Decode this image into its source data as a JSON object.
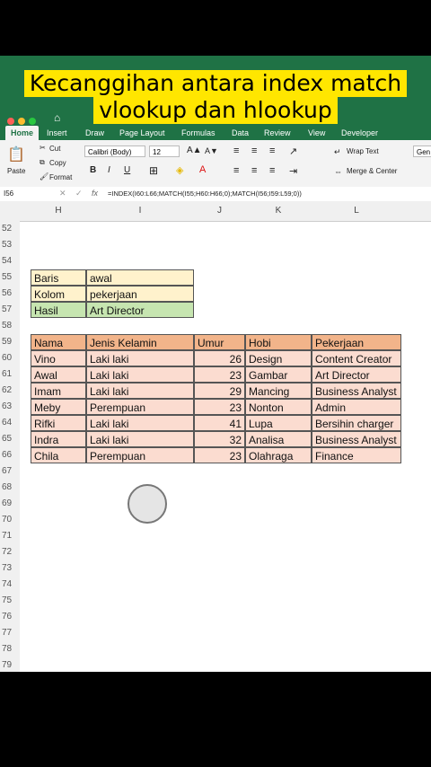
{
  "caption": {
    "line1": "Kecanggihan antara index match",
    "line2": "vlookup dan hlookup"
  },
  "ribbon": {
    "tabs": [
      "Home",
      "Insert",
      "Draw",
      "Page Layout",
      "Formulas",
      "Data",
      "Review",
      "View",
      "Developer"
    ],
    "cut": "Cut",
    "copy": "Copy",
    "format": "Format",
    "paste": "Paste",
    "font": "Calibri (Body)",
    "size": "12",
    "wrap": "Wrap Text",
    "merge": "Merge & Center",
    "gen": "Gen"
  },
  "formula_bar": {
    "cell": "I56",
    "fx": "fx",
    "formula": "=INDEX(I60:L66;MATCH(I55;H60:H66;0);MATCH(I56;I59:L59;0))"
  },
  "columns": [
    "H",
    "I",
    "J",
    "K",
    "L"
  ],
  "rows": [
    "52",
    "53",
    "54",
    "55",
    "56",
    "57",
    "58",
    "59",
    "60",
    "61",
    "62",
    "63",
    "64",
    "65",
    "66",
    "67",
    "68",
    "69",
    "70",
    "71",
    "72",
    "73",
    "74",
    "75",
    "76",
    "77",
    "78",
    "79"
  ],
  "lookup": [
    {
      "label": "Baris",
      "value": "awal"
    },
    {
      "label": "Kolom",
      "value": "pekerjaan"
    },
    {
      "label": "Hasil",
      "value": "Art Director"
    }
  ],
  "table": {
    "headers": [
      "Nama",
      "Jenis Kelamin",
      "Umur",
      "Hobi",
      "Pekerjaan"
    ],
    "rows": [
      [
        "Vino",
        "Laki laki",
        "26",
        "Design",
        "Content Creator"
      ],
      [
        "Awal",
        "Laki laki",
        "23",
        "Gambar",
        "Art Director"
      ],
      [
        "Imam",
        "Laki laki",
        "29",
        "Mancing",
        "Business Analyst"
      ],
      [
        "Meby",
        "Perempuan",
        "23",
        "Nonton",
        "Admin"
      ],
      [
        "Rifki",
        "Laki laki",
        "41",
        "Lupa",
        "Bersihin charger"
      ],
      [
        "Indra",
        "Laki laki",
        "32",
        "Analisa",
        "Business Analyst"
      ],
      [
        "Chila",
        "Perempuan",
        "23",
        "Olahraga",
        "Finance"
      ]
    ]
  },
  "colors": {
    "ribbon": "#1f7245",
    "caption_bg": "#ffe600",
    "header": "#f2b48a",
    "body": "#fbdcd0",
    "lookup_label": "#fff2cc",
    "result": "#c6e5b0"
  }
}
